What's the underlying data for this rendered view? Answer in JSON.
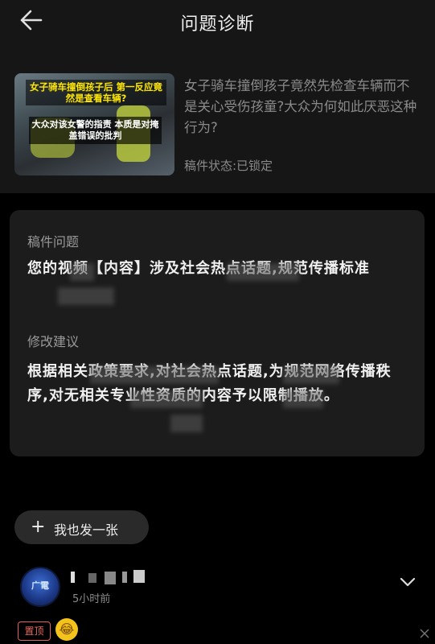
{
  "header": {
    "title": "问题诊断"
  },
  "video": {
    "thumb_caption_top": "女子骑车撞倒孩子后 第一反应竟然是查看车辆?",
    "thumb_caption_bottom": "大众对该女警的指责 本质是对掩盖错误的批判",
    "title": "女子骑车撞倒孩子竟然先检查车辆而不是关心受伤孩童?大众为何如此厌恶这种行为?",
    "status": "稿件状态:已锁定"
  },
  "issue": {
    "label": "稿件问题",
    "text": "您的视频【内容】涉及社会热点话题,规范传播标准"
  },
  "advice": {
    "label": "修改建议",
    "text": "根据相关政策要求,对社会热点话题,为规范网络传播秩序,对无相关专业性资质的内容予以限制播放。"
  },
  "actions": {
    "post_label": "我也发一张"
  },
  "post": {
    "avatar_text": "广電",
    "time": "5小时前",
    "pinned_label": "置顶",
    "emoji": "😂"
  },
  "colors": {
    "pin": "#e86a60",
    "muted": "#8a8a8a"
  }
}
